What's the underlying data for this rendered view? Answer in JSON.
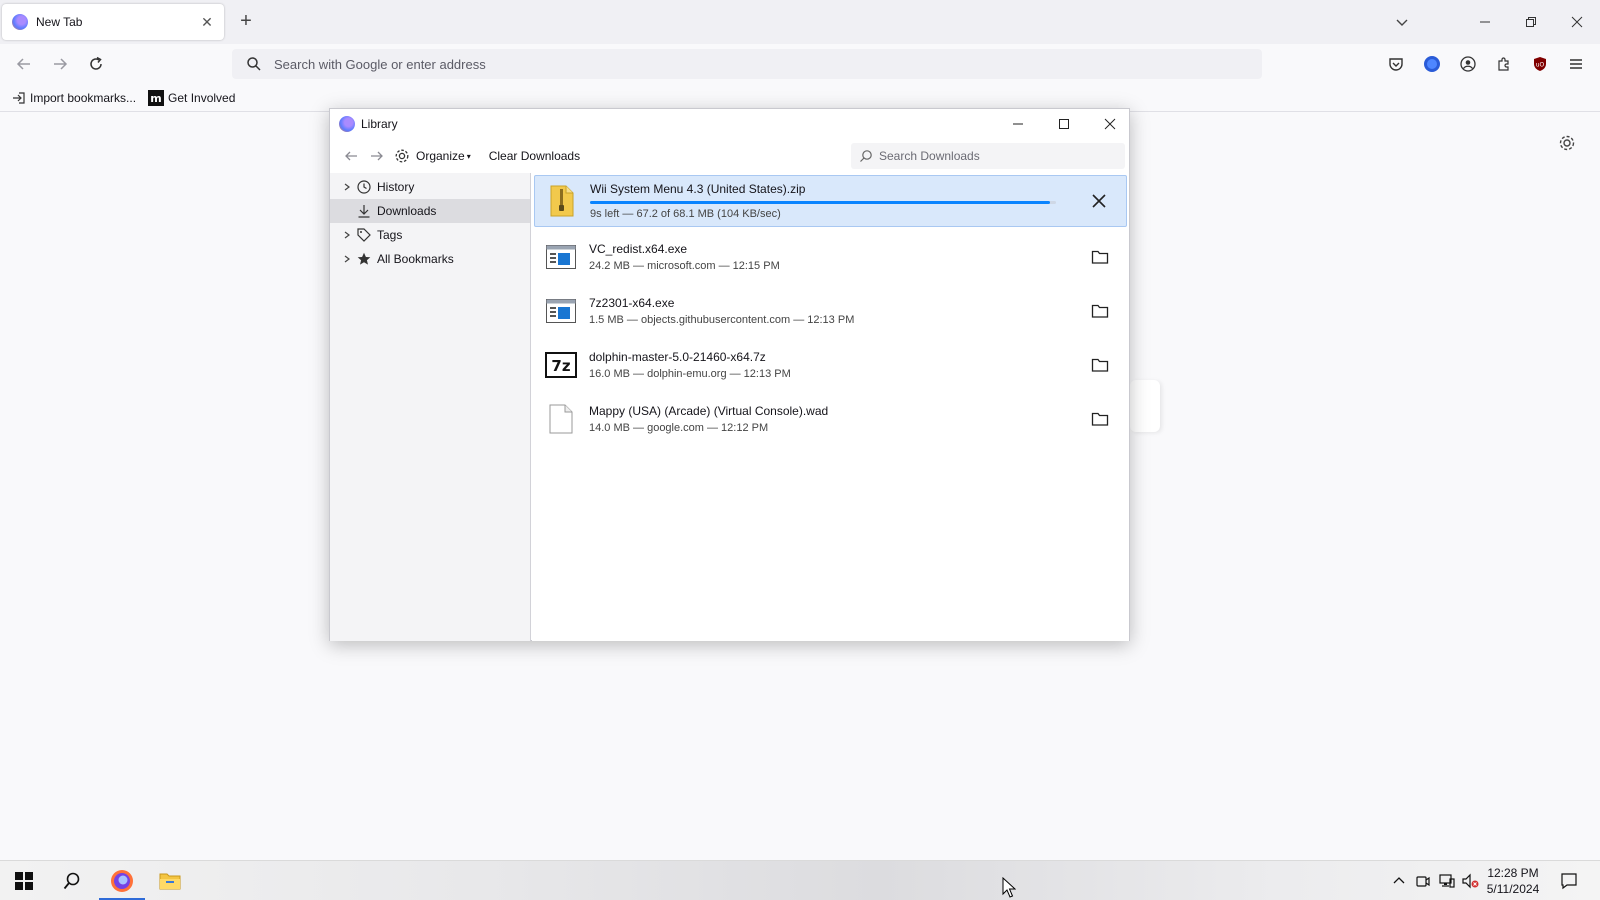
{
  "browser": {
    "tab_title": "New Tab",
    "url_placeholder": "Search with Google or enter address",
    "bookmarks": [
      {
        "label": "Import bookmarks..."
      },
      {
        "label": "Get Involved"
      }
    ]
  },
  "library": {
    "title": "Library",
    "toolbar": {
      "organize_label": "Organize",
      "clear_label": "Clear Downloads",
      "search_placeholder": "Search Downloads"
    },
    "sidebar": [
      {
        "label": "History"
      },
      {
        "label": "Downloads"
      },
      {
        "label": "Tags"
      },
      {
        "label": "All Bookmarks"
      }
    ],
    "downloads": [
      {
        "name": "Wii System Menu 4.3 (United States).zip",
        "meta": "9s left — 67.2 of 68.1 MB (104 KB/sec)",
        "progress": 0.987,
        "icon": "zip-file-icon"
      },
      {
        "name": "VC_redist.x64.exe",
        "meta": "24.2 MB — microsoft.com — 12:15 PM",
        "icon": "exe-file-icon"
      },
      {
        "name": "7z2301-x64.exe",
        "meta": "1.5 MB — objects.githubusercontent.com — 12:13 PM",
        "icon": "exe-file-icon"
      },
      {
        "name": "dolphin-master-5.0-21460-x64.7z",
        "meta": "16.0 MB — dolphin-emu.org — 12:13 PM",
        "icon": "7z-file-icon"
      },
      {
        "name": "Mappy (USA) (Arcade) (Virtual Console).wad",
        "meta": "14.0 MB — google.com — 12:12 PM",
        "icon": "generic-file-icon"
      }
    ]
  },
  "taskbar": {
    "time": "12:28 PM",
    "date": "5/11/2024"
  },
  "colors": {
    "accent": "#0a84ff",
    "selection": "#d9e8fb"
  }
}
